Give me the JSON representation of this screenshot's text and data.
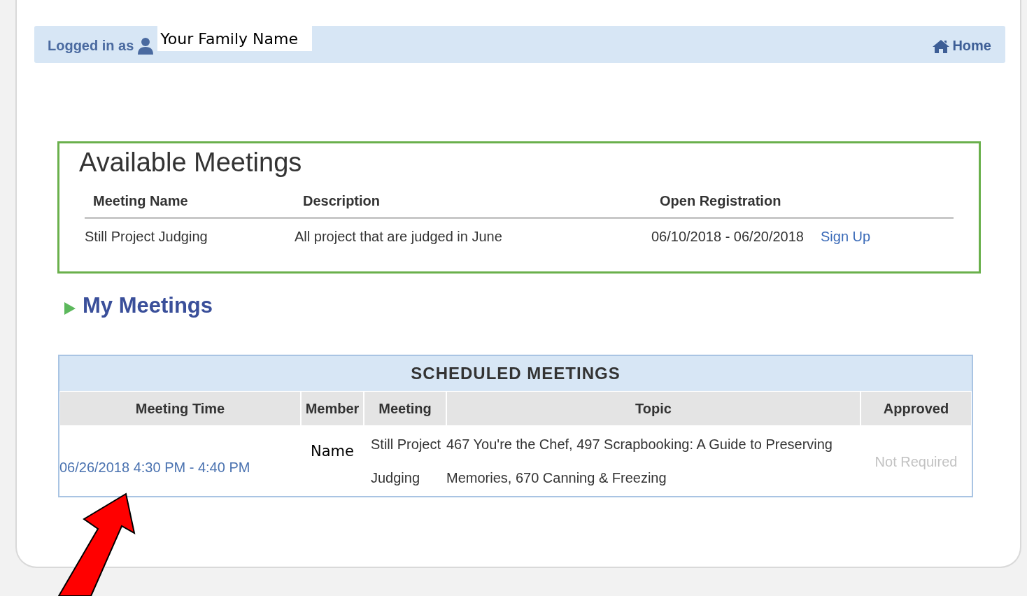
{
  "header": {
    "logged_in_label": "Logged in as",
    "user_name": "Your Family Name",
    "home_link": "Home"
  },
  "available_meetings": {
    "title": "Available Meetings",
    "columns": [
      "Meeting Name",
      "Description",
      "Open Registration"
    ],
    "rows": [
      {
        "name": "Still Project Judging",
        "description": "All project that are judged in June",
        "registration": "06/10/2018 - 06/20/2018",
        "action": "Sign Up"
      }
    ]
  },
  "my_meetings": {
    "title": "My Meetings",
    "expanded": false
  },
  "scheduled_meetings": {
    "title": "SCHEDULED MEETINGS",
    "columns": [
      "Meeting Time",
      "Member",
      "Meeting",
      "Topic",
      "Approved"
    ],
    "rows": [
      {
        "time": "06/26/2018 4:30 PM - 4:40 PM",
        "member": "Name",
        "meeting": "Still Project Judging",
        "topic": "467 You're the Chef, 497 Scrapbooking: A Guide to Preserving Memories, 670 Canning & Freezing",
        "approved": "Not Required"
      }
    ]
  }
}
